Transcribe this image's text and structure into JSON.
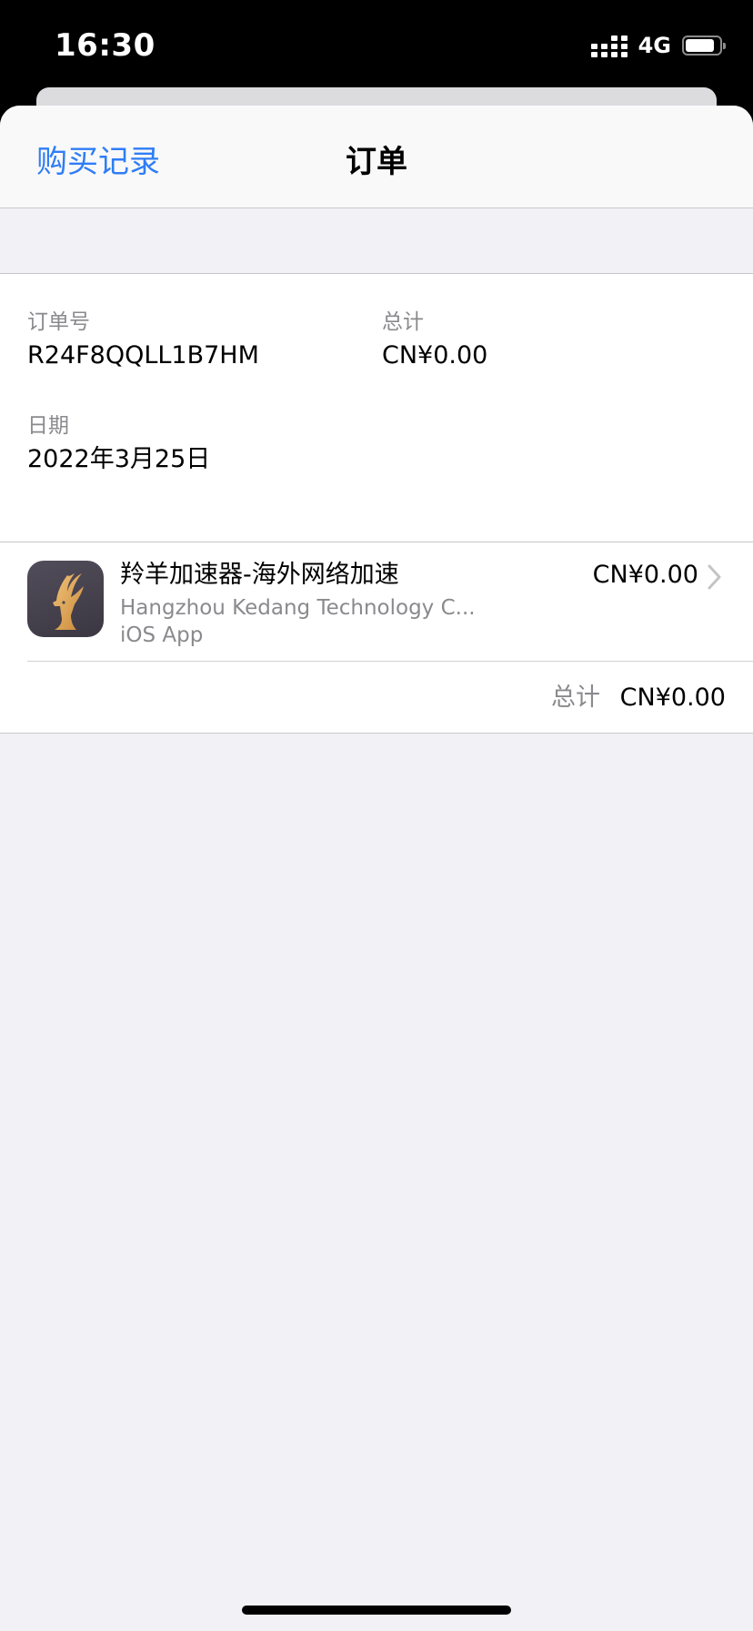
{
  "status_bar": {
    "time": "16:30",
    "network": "4G",
    "battery_level": 0.85
  },
  "nav": {
    "back_label": "购买记录",
    "title": "订单"
  },
  "order": {
    "order_number_label": "订单号",
    "order_number": "R24F8QQLL1B7HM",
    "total_label": "总计",
    "total_value": "CN¥0.00",
    "date_label": "日期",
    "date_value": "2022年3月25日"
  },
  "items": [
    {
      "name": "羚羊加速器-海外网络加速",
      "developer": "Hangzhou Kedang Technology C...",
      "type": "iOS App",
      "price": "CN¥0.00",
      "icon": "antelope-icon"
    }
  ],
  "summary": {
    "total_label": "总计",
    "total_value": "CN¥0.00"
  },
  "colors": {
    "accent": "#2f7df6",
    "background": "#f1f1f6",
    "secondary_text": "#8a8a8e"
  }
}
